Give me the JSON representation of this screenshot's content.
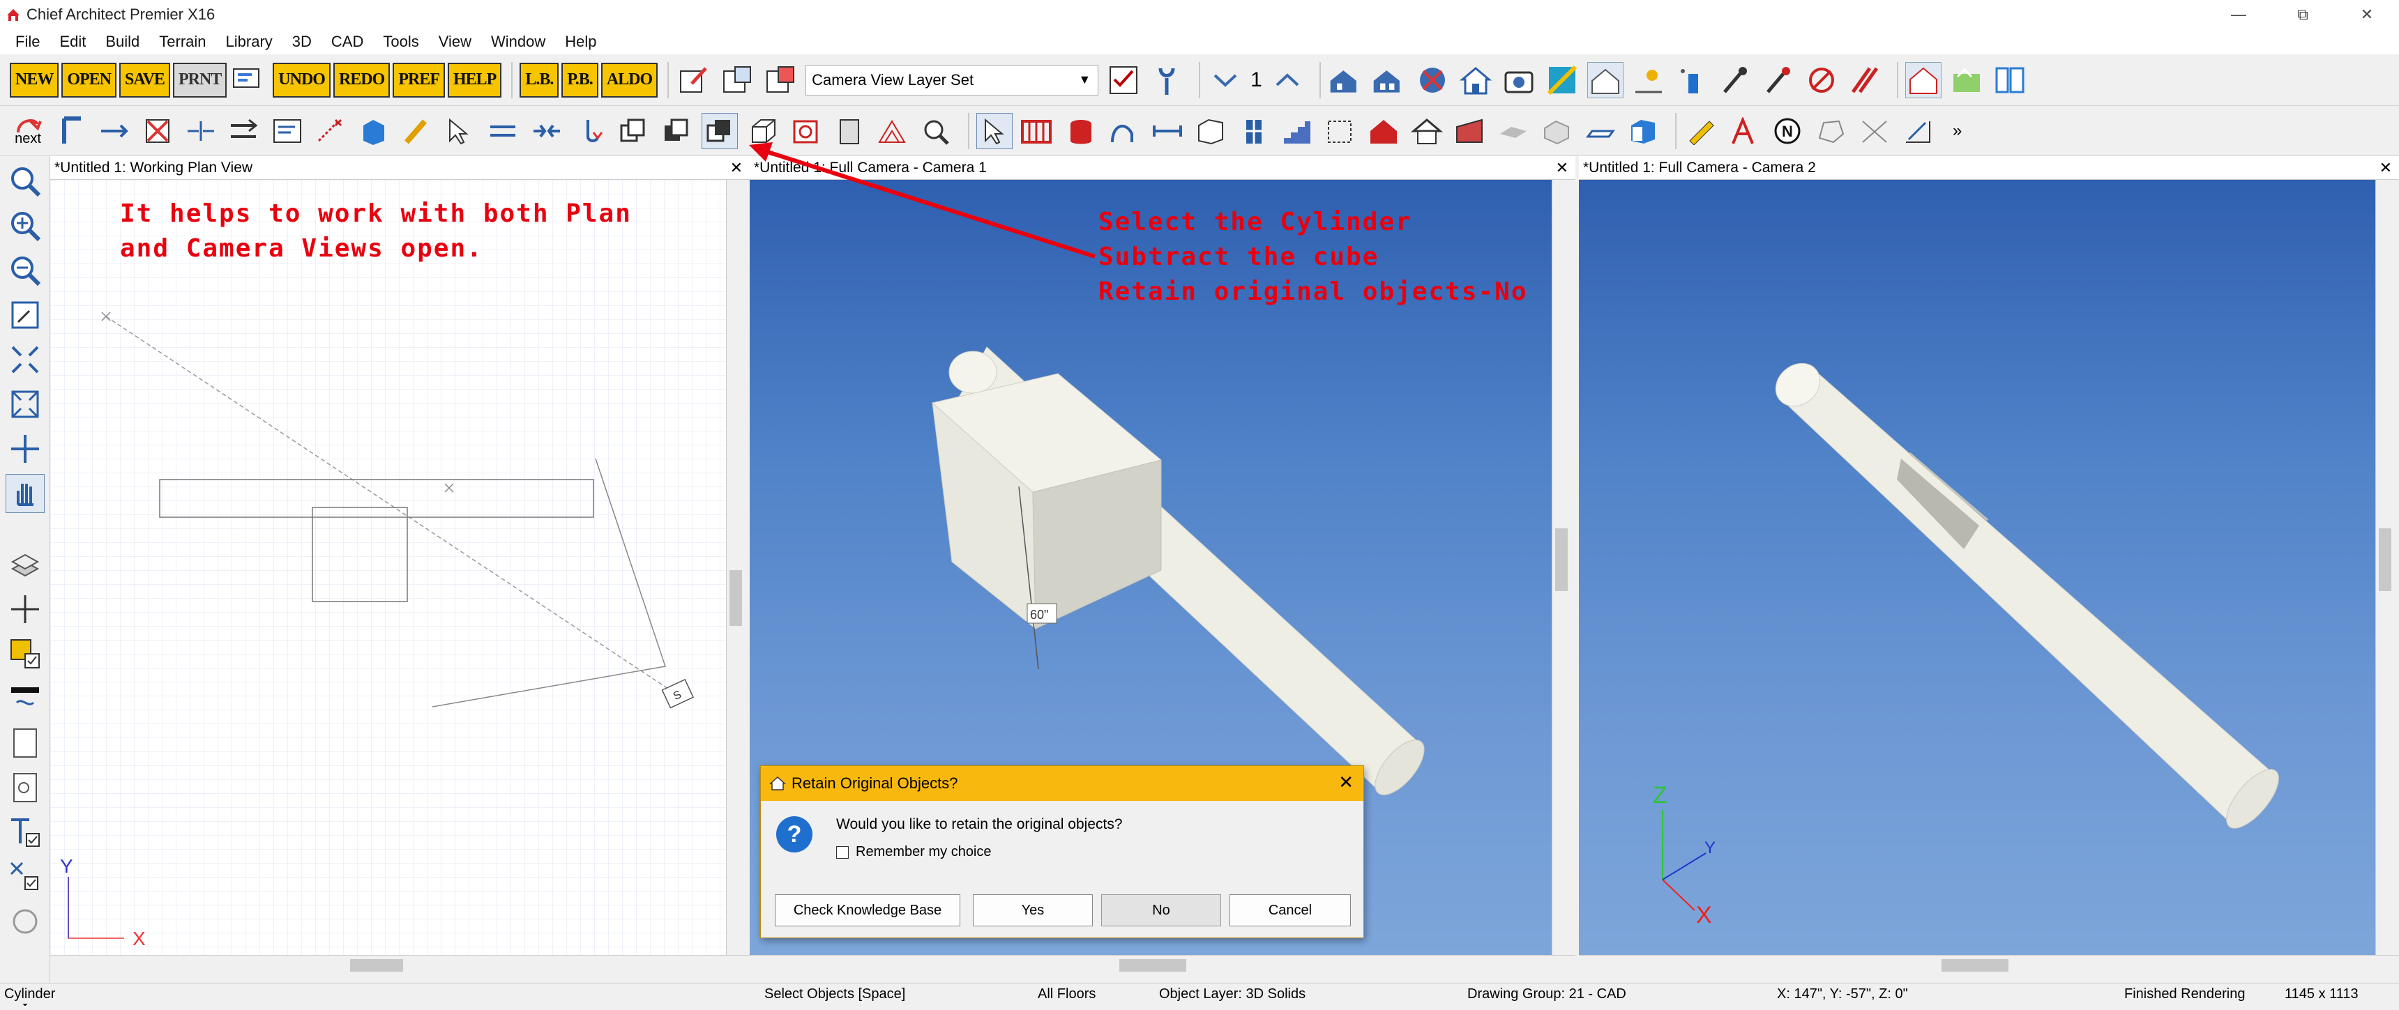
{
  "app": {
    "title": "Chief Architect Premier X16"
  },
  "menu": [
    "File",
    "Edit",
    "Build",
    "Terrain",
    "Library",
    "3D",
    "CAD",
    "Tools",
    "View",
    "Window",
    "Help"
  ],
  "toolbar": {
    "yellow_buttons": [
      "NEW",
      "OPEN",
      "SAVE",
      "PRNT",
      "UNDO",
      "REDO",
      "PREF",
      "HELP",
      "L.B.",
      "P.B.",
      "ALDO"
    ],
    "layer_set": "Camera View Layer Set",
    "floor_number": "1",
    "next_label": "next"
  },
  "panels": {
    "plan": {
      "title": "*Untitled 1:  Working Plan View",
      "annotation": "It helps to work with both Plan\nand Camera Views open."
    },
    "cam1": {
      "title": "*Untitled 1: Full Camera - Camera 1",
      "annotation": "Select the Cylinder\nSubtract the cube\nRetain original objects-No",
      "dimension": "60\""
    },
    "cam2": {
      "title": "*Untitled 1: Full Camera - Camera 2"
    }
  },
  "axes": {
    "plan_y": "Y",
    "plan_x": "X",
    "cam_z": "Z",
    "cam_y": "Y",
    "cam_x": "X",
    "camera_label": "S"
  },
  "dialog": {
    "title": "Retain Original Objects?",
    "message": "Would you like to retain the original objects?",
    "remember": "Remember my choice",
    "buttons": {
      "kb": "Check Knowledge Base",
      "yes": "Yes",
      "no": "No",
      "cancel": "Cancel"
    }
  },
  "status": {
    "selection": "Cylinder",
    "mode": "Select Objects [Space]",
    "floors": "All Floors",
    "layer": "Object Layer: 3D Solids",
    "group": "Drawing Group: 21 - CAD",
    "coords": "X: 147\", Y: -57\", Z: 0\"",
    "render": "Finished Rendering",
    "size": "1145 x 1113"
  },
  "colors": {
    "accent_yellow": "#f7c400",
    "annotation_red": "#e8000e",
    "dialog_header": "#f8b80e",
    "sky": "#4f82c8"
  }
}
